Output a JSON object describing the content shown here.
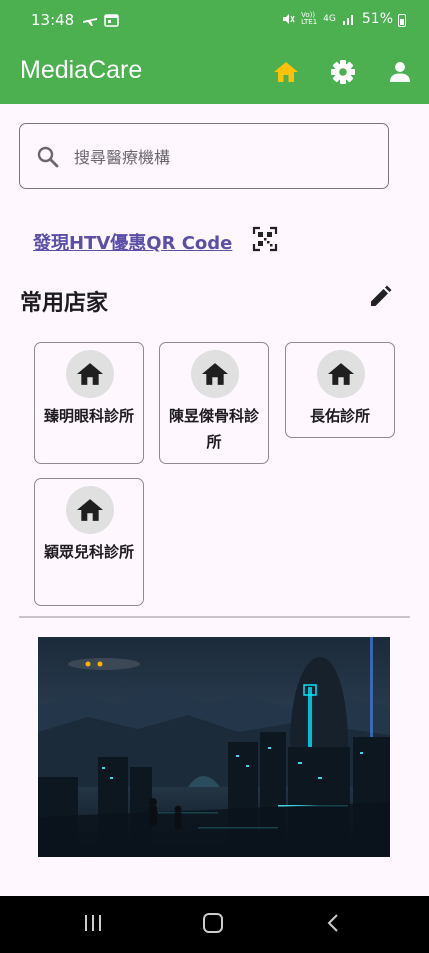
{
  "status": {
    "time": "13:48",
    "battery": "51%",
    "network": "4G",
    "volte": "Vo))\nLTE1"
  },
  "app": {
    "title": "MediaCare"
  },
  "search": {
    "placeholder": "搜尋醫療機構"
  },
  "promo": {
    "link": "發現HTV優惠QR Code"
  },
  "favorites": {
    "title": "常用店家",
    "items": [
      {
        "name": "臻明眼科診所"
      },
      {
        "name": "陳昱傑骨科診所"
      },
      {
        "name": "長佑診所"
      },
      {
        "name": "穎眾兒科診所"
      }
    ]
  },
  "colors": {
    "primary": "#4caf50",
    "home_active": "#ffc107",
    "link": "#5b4fa8",
    "background": "#fef7fe"
  },
  "icons": [
    "home-icon",
    "settings-icon",
    "account-icon",
    "search-icon",
    "qr-code-icon",
    "edit-icon",
    "store-home-icon",
    "back-icon",
    "recents-icon"
  ]
}
